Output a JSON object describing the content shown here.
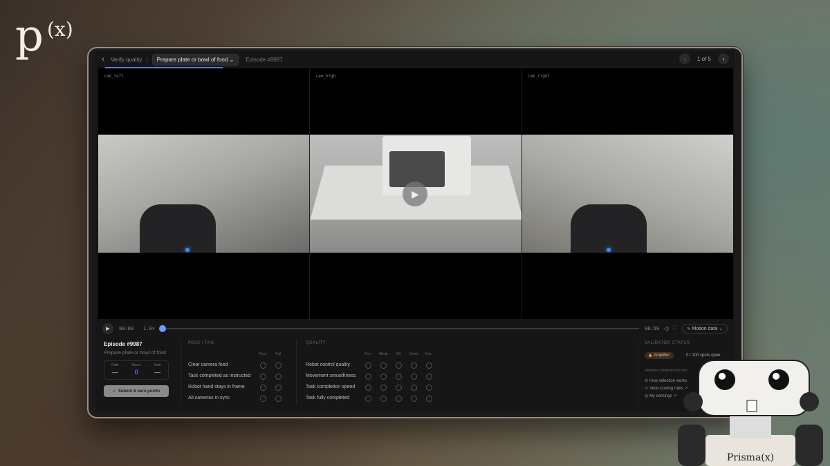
{
  "brand": {
    "letter": "p",
    "superscript": "(x)"
  },
  "topbar": {
    "crumb_parent": "Verify quality",
    "separator": "/",
    "task_pill": "Prepare plate or bowl of food",
    "episode": "Episode #9987",
    "pager": "1 of 5"
  },
  "cameras": [
    {
      "label": "cam_left"
    },
    {
      "label": "cam_high"
    },
    {
      "label": "cam_right"
    }
  ],
  "player": {
    "current_time": "00:00",
    "speed": "1.0×",
    "duration": "00:59",
    "progress": 0,
    "motion_label": "Motion data"
  },
  "episode": {
    "title": "Episode #9987",
    "subtitle": "Prepare plate or bowl of food",
    "stats": [
      {
        "label": "Gate",
        "value": "—"
      },
      {
        "label": "Score",
        "value": "0"
      },
      {
        "label": "Vote",
        "value": "—"
      }
    ],
    "submit_label": "Submit & earn points"
  },
  "pass_fail": {
    "heading": "PASS / FAIL",
    "columns": [
      "Pass",
      "Fail"
    ],
    "rows": [
      "Clear camera feed",
      "Task completed as instructed",
      "Robot hand stays in frame",
      "All cameras in sync"
    ]
  },
  "quality": {
    "heading": "QUALITY",
    "columns": [
      "Poor",
      "Weak",
      "OK",
      "Good",
      "Exc."
    ],
    "rows": [
      "Robot control quality",
      "Movement smoothness",
      "Task completion speed",
      "Task fully completed"
    ]
  },
  "validator": {
    "heading": "VALIDATOR STATUS",
    "badge": "Amplifier",
    "spots": "0 / 100 spots open",
    "line1": "Reviews completed this mo",
    "links": [
      "How selection works",
      "View scoring rules ↗",
      "My earnings ↗"
    ]
  },
  "mascot": {
    "label": "Prisma(x)"
  },
  "colors": {
    "accent": "#6f9cff",
    "badge": "#f0903a"
  }
}
